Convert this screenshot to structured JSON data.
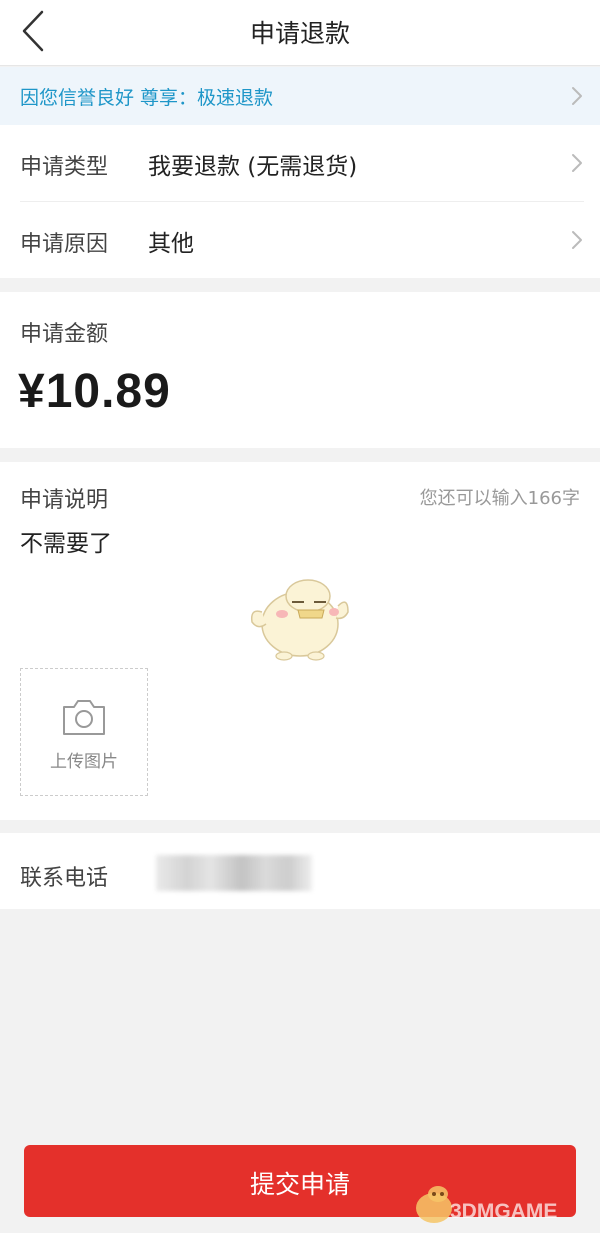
{
  "header": {
    "title": "申请退款",
    "back_icon": "chevron-left-icon"
  },
  "notice": {
    "text": "因您信誉良好 尊享：极速退款",
    "color": "#1e96c8"
  },
  "apply_type": {
    "label": "申请类型",
    "value": "我要退款 (无需退货)"
  },
  "apply_reason": {
    "label": "申请原因",
    "value": "其他"
  },
  "amount": {
    "label": "申请金额",
    "value": "¥10.89"
  },
  "description": {
    "label": "申请说明",
    "remaining_hint": "您还可以输入166字",
    "text": "不需要了"
  },
  "upload": {
    "label": "上传图片",
    "icon": "camera-icon"
  },
  "contact": {
    "label": "联系电话"
  },
  "submit": {
    "label": "提交申请",
    "color": "#e4302b"
  },
  "watermark": {
    "text": "3DMGAME"
  }
}
